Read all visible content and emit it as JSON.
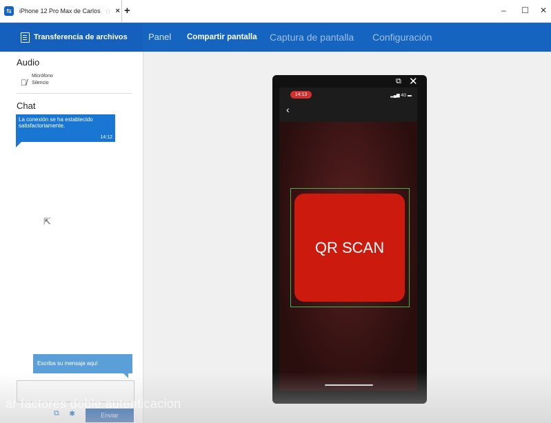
{
  "window": {
    "tab_title": "iPhone 12 Pro Max de Carlos",
    "star": "☆",
    "close_tab": "×",
    "new_tab": "+",
    "minimize": "–",
    "maximize": "☐",
    "close": "✕"
  },
  "menu": {
    "file_transfer": "Transferencia de archivos",
    "tabs": [
      "Panel",
      "Compartir pantalla",
      "Captura de pantalla",
      "Configuración"
    ],
    "active_tab": "Compartir pantalla"
  },
  "sidebar": {
    "audio_title": "Audio",
    "mic_label": "Micrófono",
    "mic_status": "Silencio",
    "chat_title": "Chat",
    "message": {
      "text": "La conexión se ha establecido satisfactoriamente.",
      "time": "14:12"
    },
    "input_placeholder": "Escriba su mensaje aquí",
    "send_label": "Enviar"
  },
  "phone": {
    "time": "14:13",
    "signal": "4G",
    "back": "‹",
    "scan_label": "QR SCAN",
    "ctl_external": "⧉",
    "ctl_close": "✕"
  },
  "caption": "ar factores doble autenticacion",
  "colors": {
    "accent": "#1565c0",
    "chat_bubble": "#1976d2",
    "scan_button": "#cc1a0e",
    "scan_frame": "#4caf50"
  }
}
